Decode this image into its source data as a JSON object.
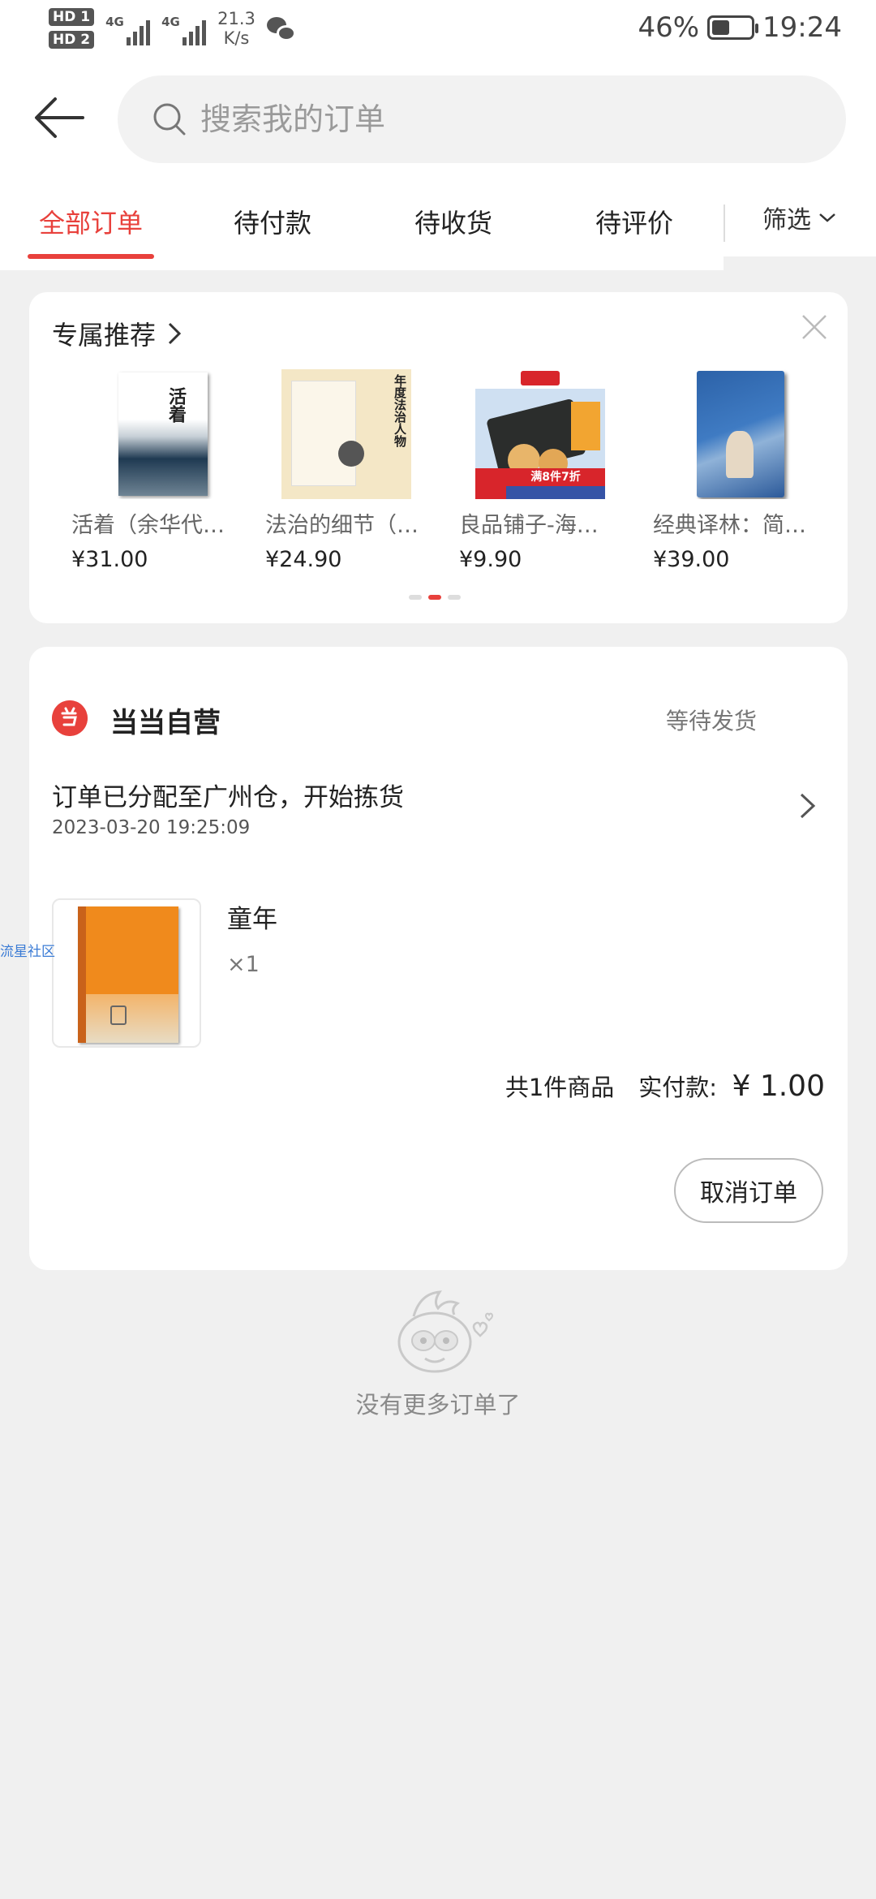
{
  "status_bar": {
    "hd1": "HD 1",
    "hd2": "HD 2",
    "net1": "4G",
    "net2": "4G",
    "speed_value": "21.3",
    "speed_unit": "K/s",
    "battery": "46%",
    "battery_level": 0.46,
    "time": "19:24"
  },
  "search": {
    "placeholder": "搜索我的订单"
  },
  "tabs": {
    "all": "全部订单",
    "pending_payment": "待付款",
    "pending_receipt": "待收货",
    "pending_review": "待评价",
    "filter": "筛选"
  },
  "recommend": {
    "title": "专属推荐",
    "items": [
      {
        "name": "活着（余华代…",
        "price": "¥31.00",
        "cover_text": "活着"
      },
      {
        "name": "法治的细节（…",
        "price": "¥24.90",
        "cover_text": "年度法治人物"
      },
      {
        "name": "良品铺子-海…",
        "price": "¥9.90",
        "cover_text": "满8件7折"
      },
      {
        "name": "经典译林：简…",
        "price": "¥39.00",
        "cover_text": ""
      }
    ]
  },
  "order": {
    "store": "当当自营",
    "status": "等待发货",
    "message": "订单已分配至广州仓，开始拣货",
    "time": "2023-03-20 19:25:09",
    "item_title": "童年",
    "item_qty": "×1",
    "count_text": "共1件商品",
    "paid_label": "实付款:",
    "paid_amount": "¥ 1.00",
    "cancel_label": "取消订单"
  },
  "side_tag": "流星社区",
  "empty_text": "没有更多订单了"
}
